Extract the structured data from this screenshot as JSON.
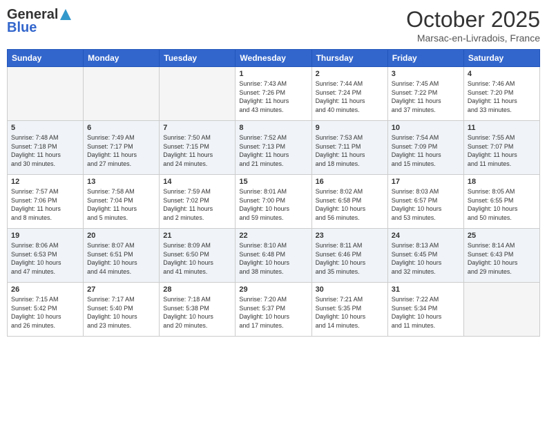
{
  "header": {
    "logo_general": "General",
    "logo_blue": "Blue",
    "month_title": "October 2025",
    "location": "Marsac-en-Livradois, France"
  },
  "weekdays": [
    "Sunday",
    "Monday",
    "Tuesday",
    "Wednesday",
    "Thursday",
    "Friday",
    "Saturday"
  ],
  "weeks": [
    [
      {
        "day": "",
        "info": ""
      },
      {
        "day": "",
        "info": ""
      },
      {
        "day": "",
        "info": ""
      },
      {
        "day": "1",
        "info": "Sunrise: 7:43 AM\nSunset: 7:26 PM\nDaylight: 11 hours\nand 43 minutes."
      },
      {
        "day": "2",
        "info": "Sunrise: 7:44 AM\nSunset: 7:24 PM\nDaylight: 11 hours\nand 40 minutes."
      },
      {
        "day": "3",
        "info": "Sunrise: 7:45 AM\nSunset: 7:22 PM\nDaylight: 11 hours\nand 37 minutes."
      },
      {
        "day": "4",
        "info": "Sunrise: 7:46 AM\nSunset: 7:20 PM\nDaylight: 11 hours\nand 33 minutes."
      }
    ],
    [
      {
        "day": "5",
        "info": "Sunrise: 7:48 AM\nSunset: 7:18 PM\nDaylight: 11 hours\nand 30 minutes."
      },
      {
        "day": "6",
        "info": "Sunrise: 7:49 AM\nSunset: 7:17 PM\nDaylight: 11 hours\nand 27 minutes."
      },
      {
        "day": "7",
        "info": "Sunrise: 7:50 AM\nSunset: 7:15 PM\nDaylight: 11 hours\nand 24 minutes."
      },
      {
        "day": "8",
        "info": "Sunrise: 7:52 AM\nSunset: 7:13 PM\nDaylight: 11 hours\nand 21 minutes."
      },
      {
        "day": "9",
        "info": "Sunrise: 7:53 AM\nSunset: 7:11 PM\nDaylight: 11 hours\nand 18 minutes."
      },
      {
        "day": "10",
        "info": "Sunrise: 7:54 AM\nSunset: 7:09 PM\nDaylight: 11 hours\nand 15 minutes."
      },
      {
        "day": "11",
        "info": "Sunrise: 7:55 AM\nSunset: 7:07 PM\nDaylight: 11 hours\nand 11 minutes."
      }
    ],
    [
      {
        "day": "12",
        "info": "Sunrise: 7:57 AM\nSunset: 7:06 PM\nDaylight: 11 hours\nand 8 minutes."
      },
      {
        "day": "13",
        "info": "Sunrise: 7:58 AM\nSunset: 7:04 PM\nDaylight: 11 hours\nand 5 minutes."
      },
      {
        "day": "14",
        "info": "Sunrise: 7:59 AM\nSunset: 7:02 PM\nDaylight: 11 hours\nand 2 minutes."
      },
      {
        "day": "15",
        "info": "Sunrise: 8:01 AM\nSunset: 7:00 PM\nDaylight: 10 hours\nand 59 minutes."
      },
      {
        "day": "16",
        "info": "Sunrise: 8:02 AM\nSunset: 6:58 PM\nDaylight: 10 hours\nand 56 minutes."
      },
      {
        "day": "17",
        "info": "Sunrise: 8:03 AM\nSunset: 6:57 PM\nDaylight: 10 hours\nand 53 minutes."
      },
      {
        "day": "18",
        "info": "Sunrise: 8:05 AM\nSunset: 6:55 PM\nDaylight: 10 hours\nand 50 minutes."
      }
    ],
    [
      {
        "day": "19",
        "info": "Sunrise: 8:06 AM\nSunset: 6:53 PM\nDaylight: 10 hours\nand 47 minutes."
      },
      {
        "day": "20",
        "info": "Sunrise: 8:07 AM\nSunset: 6:51 PM\nDaylight: 10 hours\nand 44 minutes."
      },
      {
        "day": "21",
        "info": "Sunrise: 8:09 AM\nSunset: 6:50 PM\nDaylight: 10 hours\nand 41 minutes."
      },
      {
        "day": "22",
        "info": "Sunrise: 8:10 AM\nSunset: 6:48 PM\nDaylight: 10 hours\nand 38 minutes."
      },
      {
        "day": "23",
        "info": "Sunrise: 8:11 AM\nSunset: 6:46 PM\nDaylight: 10 hours\nand 35 minutes."
      },
      {
        "day": "24",
        "info": "Sunrise: 8:13 AM\nSunset: 6:45 PM\nDaylight: 10 hours\nand 32 minutes."
      },
      {
        "day": "25",
        "info": "Sunrise: 8:14 AM\nSunset: 6:43 PM\nDaylight: 10 hours\nand 29 minutes."
      }
    ],
    [
      {
        "day": "26",
        "info": "Sunrise: 7:15 AM\nSunset: 5:42 PM\nDaylight: 10 hours\nand 26 minutes."
      },
      {
        "day": "27",
        "info": "Sunrise: 7:17 AM\nSunset: 5:40 PM\nDaylight: 10 hours\nand 23 minutes."
      },
      {
        "day": "28",
        "info": "Sunrise: 7:18 AM\nSunset: 5:38 PM\nDaylight: 10 hours\nand 20 minutes."
      },
      {
        "day": "29",
        "info": "Sunrise: 7:20 AM\nSunset: 5:37 PM\nDaylight: 10 hours\nand 17 minutes."
      },
      {
        "day": "30",
        "info": "Sunrise: 7:21 AM\nSunset: 5:35 PM\nDaylight: 10 hours\nand 14 minutes."
      },
      {
        "day": "31",
        "info": "Sunrise: 7:22 AM\nSunset: 5:34 PM\nDaylight: 10 hours\nand 11 minutes."
      },
      {
        "day": "",
        "info": ""
      }
    ]
  ]
}
